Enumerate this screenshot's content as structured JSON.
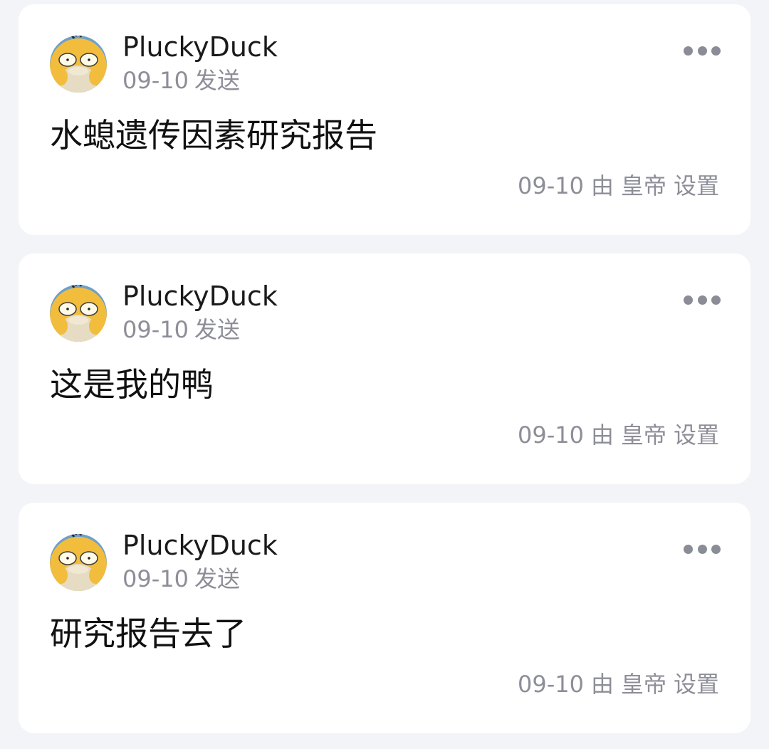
{
  "icons": {
    "avatar": "psyduck-avatar-icon",
    "more": "more-horizontal-icon"
  },
  "colors": {
    "background": "#f3f4f8",
    "card": "#ffffff",
    "primary_text": "#111111",
    "secondary_text": "#8e8e99"
  },
  "posts": [
    {
      "username": "PluckyDuck",
      "sent_date": "09-10",
      "sent_label": "发送",
      "content": "水螅遗传因素研究报告",
      "footer_date": "09-10",
      "footer_by": "由",
      "footer_user": "皇帝",
      "footer_action": "设置"
    },
    {
      "username": "PluckyDuck",
      "sent_date": "09-10",
      "sent_label": "发送",
      "content": "这是我的鸭",
      "footer_date": "09-10",
      "footer_by": "由",
      "footer_user": "皇帝",
      "footer_action": "设置"
    },
    {
      "username": "PluckyDuck",
      "sent_date": "09-10",
      "sent_label": "发送",
      "content": "研究报告去了",
      "footer_date": "09-10",
      "footer_by": "由",
      "footer_user": "皇帝",
      "footer_action": "设置"
    }
  ]
}
